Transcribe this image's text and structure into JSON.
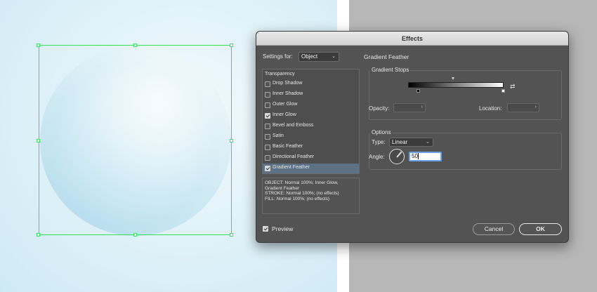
{
  "dialog": {
    "title": "Effects",
    "settings_for_label": "Settings for:",
    "settings_for_value": "Object",
    "panel_title": "Gradient Feather",
    "transparency_label": "Transparency",
    "effects": [
      {
        "label": "Drop Shadow",
        "checked": false
      },
      {
        "label": "Inner Shadow",
        "checked": false
      },
      {
        "label": "Outer Glow",
        "checked": false
      },
      {
        "label": "Inner Glow",
        "checked": true
      },
      {
        "label": "Bevel and Emboss",
        "checked": false
      },
      {
        "label": "Satin",
        "checked": false
      },
      {
        "label": "Basic Feather",
        "checked": false
      },
      {
        "label": "Directional Feather",
        "checked": false
      },
      {
        "label": "Gradient Feather",
        "checked": true,
        "selected": true
      }
    ],
    "summary": [
      "OBJECT: Normal 100%; Inner Glow,",
      "Gradient Feather",
      "STROKE: Normal 100%; (no effects)",
      "FILL: Normal 100%; (no effects)"
    ],
    "gradient_stops": {
      "title": "Gradient Stops",
      "opacity_label": "Opacity:",
      "location_label": "Location:",
      "opacity_value": "",
      "location_value": ""
    },
    "options": {
      "title": "Options",
      "type_label": "Type:",
      "type_value": "Linear",
      "angle_label": "Angle:",
      "angle_value": "50",
      "angle_degrees": 50
    },
    "preview_label": "Preview",
    "preview_checked": true,
    "cancel_label": "Cancel",
    "ok_label": "OK"
  },
  "icons": {
    "dropdown": "chevron-down-icon",
    "stepper": "chevron-right-icon",
    "reverse_gradient": "reverse-gradient-icon"
  },
  "colors": {
    "dialog_bg": "#535353",
    "selection_green": "#35e05a",
    "selected_row": "#5c7186",
    "focus_ring": "#6aa1e6"
  }
}
